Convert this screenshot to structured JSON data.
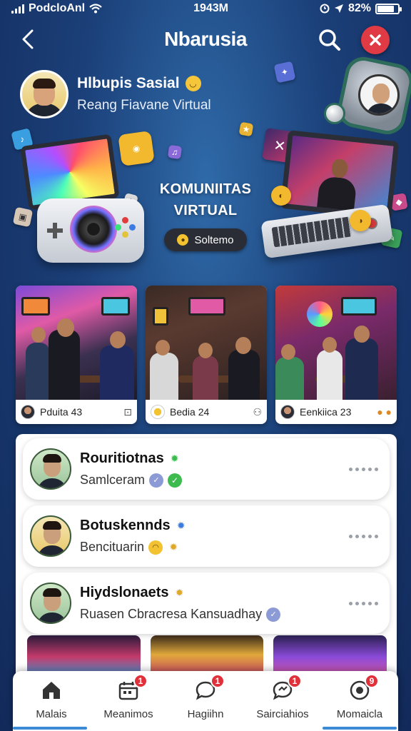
{
  "status_bar": {
    "carrier": "PodcloAnl",
    "time": "1943M",
    "battery": "82%",
    "battery_level": 0.82
  },
  "header": {
    "title": "Nbarusia"
  },
  "profile": {
    "name": "Hlbupis Sasial",
    "subtitle": "Reang Fiavane Virtual"
  },
  "hero": {
    "title": "KOMUNIITAS VIRTUAL",
    "button_label": "Soltemo"
  },
  "rooms": [
    {
      "name": "Pduita 43"
    },
    {
      "name": "Bedia 24"
    },
    {
      "name": "Eenkiica 23"
    }
  ],
  "posts": [
    {
      "name": "Rouritiotnas",
      "subtitle": "Samlceram"
    },
    {
      "name": "Botuskennds",
      "subtitle": "Bencituarin"
    },
    {
      "name": "Hiydslonaets",
      "subtitle": "Ruasen Cbracresa Kansuadhay"
    }
  ],
  "nav": [
    {
      "label": "Malais",
      "badge": ""
    },
    {
      "label": "Meanimos",
      "badge": "1"
    },
    {
      "label": "Hagiihn",
      "badge": "1"
    },
    {
      "label": "Sairciahios",
      "badge": "1"
    },
    {
      "label": "Momaicla",
      "badge": "9"
    }
  ],
  "colors": {
    "accent_red": "#e03a44",
    "nav_underline": "#3b8ad6",
    "background": "#1b3f78"
  }
}
